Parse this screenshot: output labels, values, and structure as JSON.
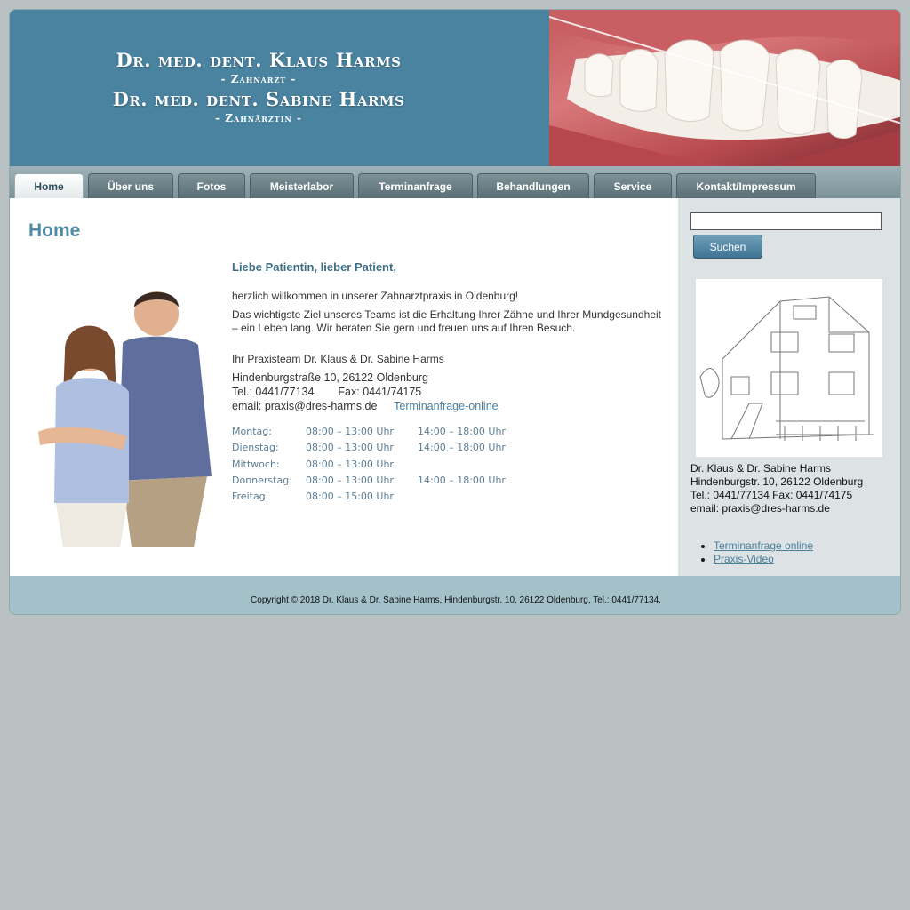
{
  "header": {
    "line1": "Dr. med. dent. Klaus Harms",
    "role1": "- Zahnarzt -",
    "line2": "Dr. med. dent. Sabine Harms",
    "role2": "- Zahnärztin -"
  },
  "nav": [
    {
      "label": "Home",
      "active": true
    },
    {
      "label": "Über uns"
    },
    {
      "label": "Fotos"
    },
    {
      "label": "Meisterlabor"
    },
    {
      "label": "Terminanfrage"
    },
    {
      "label": "Behandlungen"
    },
    {
      "label": "Service"
    },
    {
      "label": "Kontakt/Impressum"
    }
  ],
  "main": {
    "heading": "Home",
    "greeting": "Liebe Patientin, lieber Patient,",
    "welcome": "herzlich willkommen in unserer Zahnarztpraxis in Oldenburg!",
    "goal": "Das wichtigste Ziel unseres Teams ist die Erhaltung Ihrer Zähne und Ihrer Mundgesundheit – ein Leben lang. Wir beraten Sie gern und freuen uns auf Ihren Besuch.",
    "signature": "Ihr Praxisteam Dr. Klaus & Dr. Sabine Harms",
    "street": "Hindenburgstraße 10,  26122 Oldenburg",
    "tel": "Tel.: 0441/77134",
    "fax": "Fax: 0441/74175",
    "email": "email: praxis@dres-harms.de",
    "link": "Terminanfrage-online",
    "hours": [
      {
        "day": "Montag:",
        "morning": "08:00 – 13:00 Uhr",
        "afternoon": "14:00 – 18:00 Uhr"
      },
      {
        "day": "Dienstag:",
        "morning": "08:00 – 13:00 Uhr",
        "afternoon": "14:00 – 18:00 Uhr"
      },
      {
        "day": "Mittwoch:",
        "morning": "08:00 – 13:00 Uhr",
        "afternoon": ""
      },
      {
        "day": "Donnerstag:",
        "morning": "08:00 – 13:00 Uhr",
        "afternoon": "14:00 – 18:00 Uhr"
      },
      {
        "day": "Freitag:",
        "morning": "08:00 – 15:00 Uhr",
        "afternoon": ""
      }
    ]
  },
  "sidebar": {
    "search_value": "",
    "search_button": "Suchen",
    "contact": [
      "Dr. Klaus & Dr. Sabine Harms",
      "Hindenburgstr. 10, 26122 Oldenburg",
      "Tel.: 0441/77134 Fax: 0441/74175",
      "email: praxis@dres-harms.de"
    ],
    "links": [
      "Terminanfrage online",
      "Praxis-Video"
    ]
  },
  "footer": {
    "copyright": "Copyright © 2018 Dr. Klaus & Dr. Sabine Harms, Hindenburgstr. 10, 26122 Oldenburg, Tel.: 0441/77134."
  },
  "colors": {
    "header_blue": "#4a83a0",
    "heading_blue": "#4f8aa6",
    "link_blue": "#4a7fa0",
    "page_bg": "#b9c1c3"
  }
}
